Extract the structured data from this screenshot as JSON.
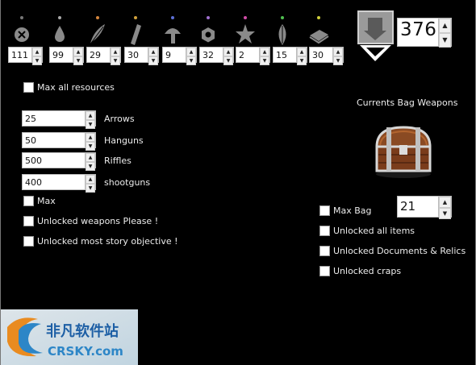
{
  "resources": [
    {
      "name": "crossed-circle-icon",
      "value": "111",
      "dot": "#777777"
    },
    {
      "name": "drop-icon",
      "value": "99",
      "dot": "#aaaaaa"
    },
    {
      "name": "feather-icon",
      "value": "29",
      "dot": "#d4863c"
    },
    {
      "name": "stick-icon",
      "value": "30",
      "dot": "#d1a23c"
    },
    {
      "name": "mushroom-icon",
      "value": "9",
      "dot": "#5c6fd6"
    },
    {
      "name": "hexagon-nut-icon",
      "value": "32",
      "dot": "#a070d0"
    },
    {
      "name": "star-icon",
      "value": "2",
      "dot": "#d14da8"
    },
    {
      "name": "leaf-icon",
      "value": "15",
      "dot": "#4fbf4f"
    },
    {
      "name": "book-icon",
      "value": "30",
      "dot": "#cfcf3a"
    }
  ],
  "total": {
    "value": "376"
  },
  "max_all_resources_label": "Max all resources",
  "weapons": [
    {
      "value": "25",
      "label": "Arrows"
    },
    {
      "value": "50",
      "label": "Hanguns"
    },
    {
      "value": "500",
      "label": "Riffles"
    },
    {
      "value": "400",
      "label": "shootguns"
    }
  ],
  "max_label": "Max",
  "unlock_weapons_label": "Unlocked weapons Please !",
  "unlock_story_label": "Unlocked most story objective !",
  "bag": {
    "title": "Currents Bag Weapons",
    "max_bag_label": "Max Bag",
    "max_bag_value": "21",
    "unlock_all_items_label": "Unlocked all items",
    "unlock_documents_label": "Unlocked Documents & Relics",
    "unlock_craps_label": "Unlocked craps"
  },
  "watermark": {
    "brand": "非凡软件站",
    "site": "CRSKY.com"
  },
  "colors": {
    "background": "#000000",
    "text": "#ececec",
    "icon": "#8a8a8a",
    "spin_field": "#ffffff"
  }
}
